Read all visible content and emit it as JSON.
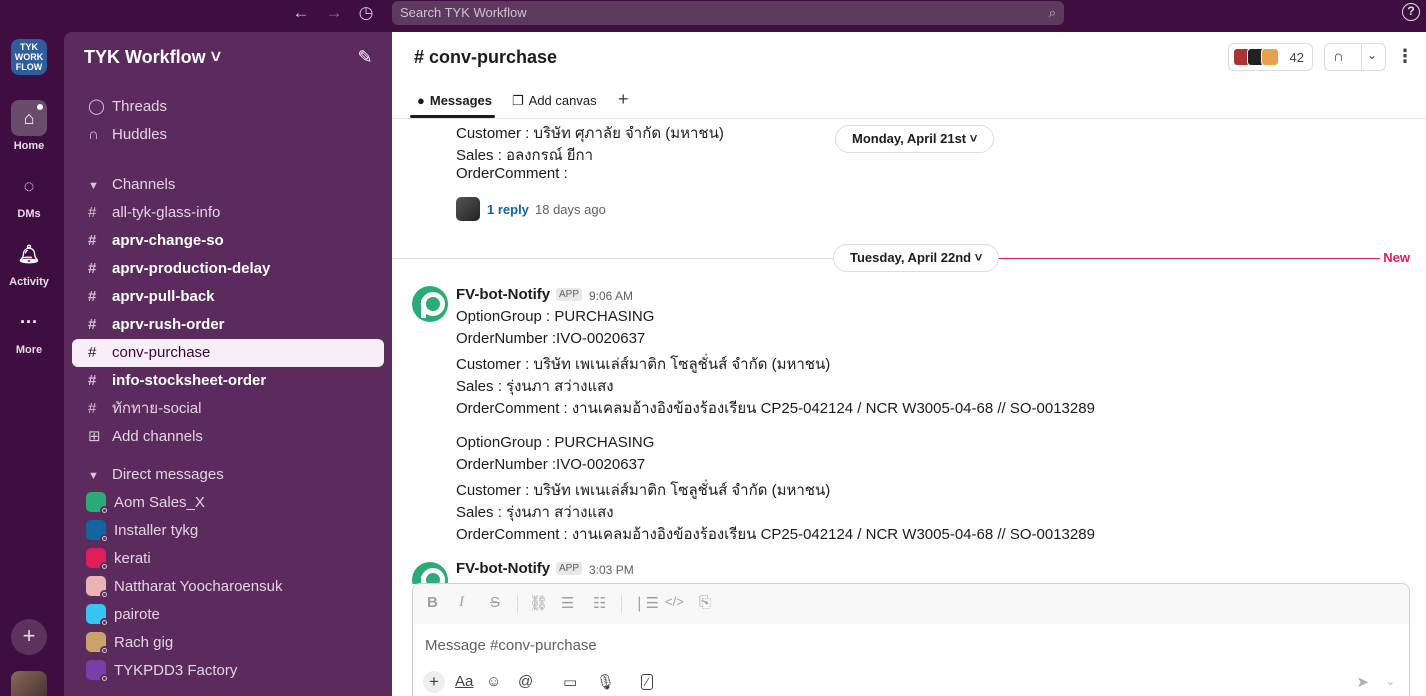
{
  "topbar": {
    "search_placeholder": "Search TYK Workflow",
    "back_icon": "←",
    "forward_icon": "→",
    "history_icon": "◷",
    "search_icon": "⌕",
    "help_icon": "?"
  },
  "rail": {
    "workspace_logo": "TYK\nWORK\nFLOW",
    "items": [
      {
        "label": "Home",
        "icon": "⌂"
      },
      {
        "label": "DMs",
        "icon": "◌"
      },
      {
        "label": "Activity",
        "icon": "♫"
      },
      {
        "label": "More",
        "icon": "···"
      }
    ],
    "add_icon": "+"
  },
  "sidebar": {
    "workspace_name": "TYK Workflow ˅",
    "compose_icon": "✎",
    "threads": "Threads",
    "huddles": "Huddles",
    "channels_header": "Channels",
    "channels": [
      {
        "name": "all-tyk-glass-info",
        "bold": false
      },
      {
        "name": "aprv-change-so",
        "bold": true
      },
      {
        "name": "aprv-production-delay",
        "bold": true
      },
      {
        "name": "aprv-pull-back",
        "bold": true
      },
      {
        "name": "aprv-rush-order",
        "bold": true
      },
      {
        "name": "conv-purchase",
        "bold": false,
        "active": true
      },
      {
        "name": "info-stocksheet-order",
        "bold": true
      },
      {
        "name": "ทักทาย-social",
        "bold": false
      }
    ],
    "add_channels": "Add channels",
    "dm_header": "Direct messages",
    "dms": [
      {
        "name": "Aom Sales_X",
        "color": "#2bac76"
      },
      {
        "name": "Installer tykg",
        "color": "#1264a3"
      },
      {
        "name": "kerati",
        "color": "#e01e5a"
      },
      {
        "name": "Nattharat Yoocharoensuk",
        "color": "#e8b4b8"
      },
      {
        "name": "pairote",
        "color": "#36c5f0"
      },
      {
        "name": "Rach gig",
        "color": "#c9a36b"
      },
      {
        "name": "TYKPDD3 Factory",
        "color": "#7c3fa8"
      }
    ]
  },
  "channel": {
    "title": "# conv-purchase",
    "member_count": "42",
    "headphones_icon": "🎧",
    "chevron_icon": "⌄",
    "kebab_icon": "⋮",
    "tabs": [
      {
        "label": "Messages",
        "icon": "●"
      },
      {
        "label": "Add canvas",
        "icon": "❐"
      }
    ],
    "tab_add_icon": "+"
  },
  "messages": {
    "prev_lines": [
      "Customer : บริษัท ศุภาลัย จำกัด (มหาชน)",
      "Sales : อลงกรณ์ ยีกา",
      "OrderComment :"
    ],
    "prev_reply": "1 reply",
    "prev_reply_time": "18 days ago",
    "date1": "Monday, April 21st ˅",
    "date2": "Tuesday, April 22nd ˅",
    "new_label": "New",
    "msg1": {
      "sender": "FV-bot-Notify",
      "badge": "APP",
      "time": "9:06 AM",
      "block1": [
        "OptionGroup : PURCHASING",
        "OrderNumber :IVO-0020637",
        "Customer : บริษัท เพเนเล่ส์มาติก โซลูชั่นส์  จำกัด (มหาชน)",
        "Sales : รุ่งนภา สว่างแสง",
        "OrderComment : งานเคลมอ้างอิงข้องร้องเรียน CP25-042124 / NCR W3005-04-68 // SO-0013289"
      ],
      "block2": [
        "OptionGroup : PURCHASING",
        "OrderNumber :IVO-0020637",
        "Customer : บริษัท เพเนเล่ส์มาติก โซลูชั่นส์  จำกัด (มหาชน)",
        "Sales : รุ่งนภา สว่างแสง",
        "OrderComment : งานเคลมอ้างอิงข้องร้องเรียน CP25-042124 / NCR W3005-04-68 // SO-0013289"
      ]
    },
    "msg2": {
      "sender": "FV-bot-Notify",
      "badge": "APP",
      "time": "3:03 PM"
    }
  },
  "composer": {
    "placeholder": "Message #conv-purchase",
    "format_icons": [
      "B",
      "I",
      "S",
      "⛓",
      "☰",
      "☷",
      "❘☰",
      "</>",
      "⎘"
    ],
    "tools": [
      "Aa",
      "☺",
      "@",
      "▭",
      "🎙",
      "⁄"
    ],
    "plus_icon": "+",
    "send_icon": "➤",
    "send_chevron": "⌄"
  },
  "colors": {
    "aubergine": "#3f0e40",
    "sidebar": "#5a2b5c",
    "link": "#1264a3",
    "new": "#e01e5a",
    "bot": "#2bac76"
  }
}
